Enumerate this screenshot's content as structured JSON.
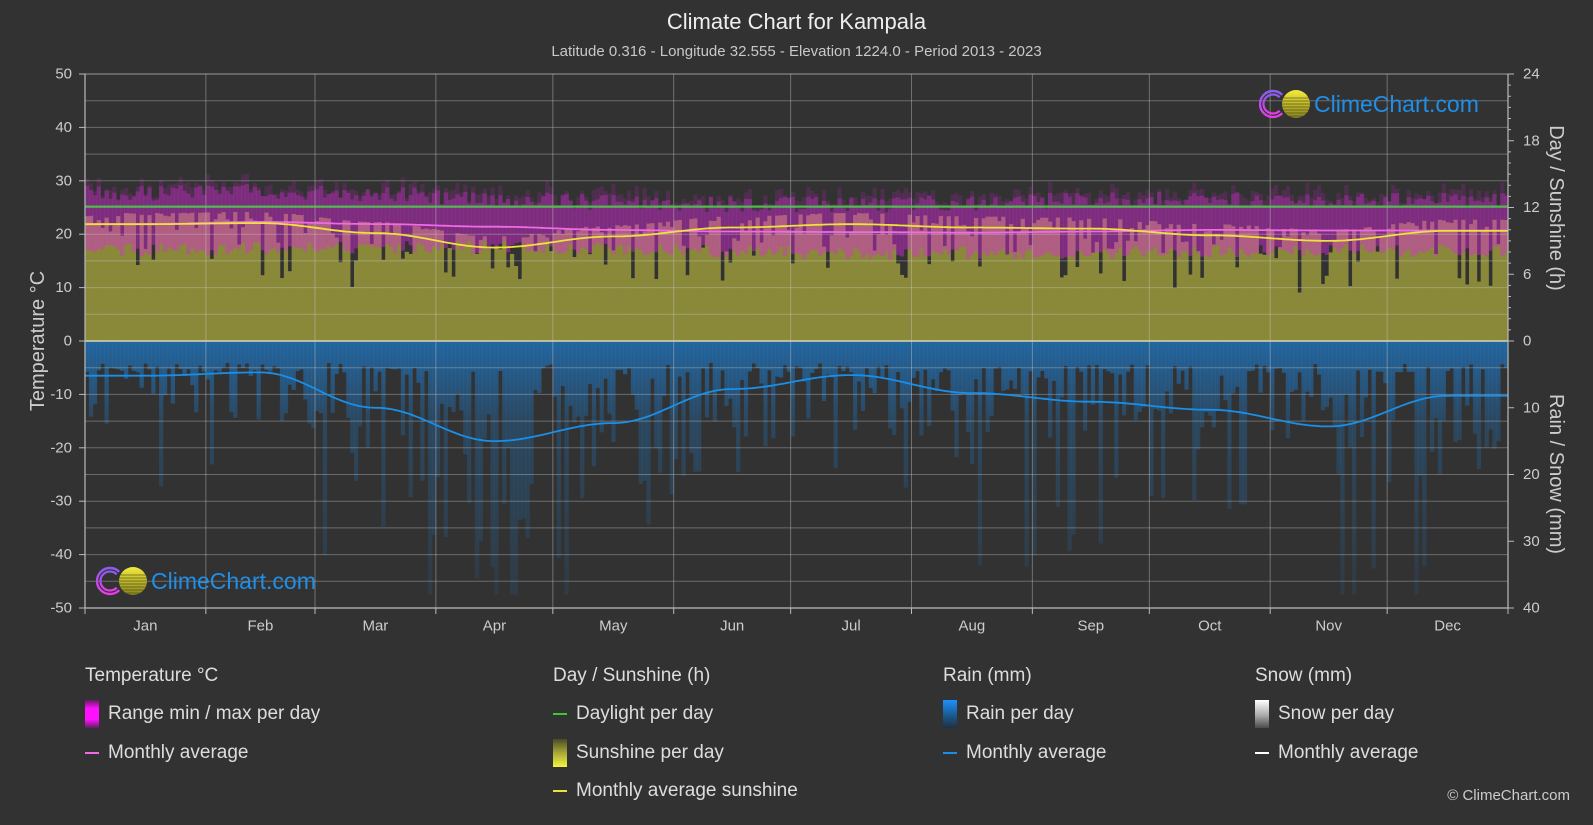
{
  "chart_data": {
    "type": "line",
    "title": "Climate Chart for Kampala",
    "subtitle": "Latitude 0.316 - Longitude 32.555 - Elevation 1224.0 - Period 2013 - 2023",
    "categories": [
      "Jan",
      "Feb",
      "Mar",
      "Apr",
      "May",
      "Jun",
      "Jul",
      "Aug",
      "Sep",
      "Oct",
      "Nov",
      "Dec"
    ],
    "axes": {
      "temperature": {
        "label": "Temperature °C",
        "side": "left",
        "range": [
          -50,
          50
        ],
        "ticks": [
          50,
          40,
          30,
          20,
          10,
          0,
          -10,
          -20,
          -30,
          -40,
          -50
        ]
      },
      "sunshine": {
        "label": "Day / Sunshine (h)",
        "side": "right-upper",
        "range": [
          0,
          24
        ],
        "ticks": [
          24,
          18,
          12,
          6,
          0
        ]
      },
      "precipitation": {
        "label": "Rain / Snow (mm)",
        "side": "right-lower",
        "range": [
          0,
          40
        ],
        "ticks": [
          10,
          20,
          30,
          40
        ]
      }
    },
    "series": [
      {
        "id": "temp_avg",
        "name": "Temperature monthly average (°C)",
        "axis": "temperature",
        "kind": "line",
        "values": [
          21.9,
          22.3,
          21.9,
          21.4,
          20.8,
          20.5,
          20.4,
          20.3,
          20.5,
          20.8,
          20.7,
          20.7
        ]
      },
      {
        "id": "temp_range",
        "name": "Range min / max per day (°C, approximate monthly band)",
        "axis": "temperature",
        "kind": "band",
        "min": [
          17.0,
          17.3,
          17.6,
          17.6,
          17.4,
          16.8,
          16.4,
          16.5,
          16.6,
          16.9,
          17.0,
          16.9
        ],
        "max": [
          27.8,
          28.2,
          27.5,
          26.5,
          26.0,
          25.6,
          25.5,
          25.9,
          26.4,
          26.5,
          26.1,
          26.4
        ]
      },
      {
        "id": "daylight",
        "name": "Daylight per day (h)",
        "axis": "sunshine",
        "kind": "line",
        "values": [
          12.1,
          12.1,
          12.1,
          12.1,
          12.1,
          12.1,
          12.1,
          12.1,
          12.1,
          12.1,
          12.1,
          12.1
        ]
      },
      {
        "id": "sunshine_avg",
        "name": "Monthly average sunshine (h)",
        "axis": "sunshine",
        "kind": "line",
        "values": [
          10.5,
          10.6,
          9.7,
          8.4,
          9.4,
          10.2,
          10.5,
          10.2,
          10.1,
          9.5,
          9.0,
          9.9
        ]
      },
      {
        "id": "rain_avg",
        "name": "Rain monthly average (mm)",
        "axis": "precipitation",
        "kind": "line",
        "values": [
          5.2,
          4.7,
          10.0,
          15.0,
          12.3,
          7.2,
          5.1,
          7.8,
          9.1,
          10.3,
          12.8,
          8.2
        ]
      }
    ],
    "grid": true,
    "legend_position": "bottom"
  },
  "colors": {
    "background": "#323232",
    "text": "#cccccc",
    "grid": "#c8c8c8",
    "axis": "#bbbbbb",
    "zero_line": "#d9d5a8",
    "daylight": "#33cc33",
    "temperature_avg": "#f06ae6",
    "temperature_range": "#e028e0",
    "sunshine_bar": "#8a893a",
    "sunshine_avg": "#ece23a",
    "rain_bar": "#1f74bd",
    "rain_avg": "#1a8fe8",
    "snow_avg": "#ffffff",
    "logo_text": "#1f8fe8"
  },
  "logo": {
    "text": "ClimeChart.com",
    "icon": "climechart-logo-icon"
  },
  "legend": {
    "groups": [
      {
        "title": "Temperature °C",
        "items": [
          {
            "label": "Range min / max per day",
            "icon": "magenta-gradient-swatch"
          },
          {
            "label": "Monthly average",
            "icon": "pink-line"
          }
        ]
      },
      {
        "title": "Day / Sunshine (h)",
        "items": [
          {
            "label": "Daylight per day",
            "icon": "green-line"
          },
          {
            "label": "Sunshine per day",
            "icon": "yellow-gradient-swatch"
          },
          {
            "label": "Monthly average sunshine",
            "icon": "yellow-line"
          }
        ]
      },
      {
        "title": "Rain (mm)",
        "items": [
          {
            "label": "Rain per day",
            "icon": "blue-gradient-swatch"
          },
          {
            "label": "Monthly average",
            "icon": "blue-line"
          }
        ]
      },
      {
        "title": "Snow (mm)",
        "items": [
          {
            "label": "Snow per day",
            "icon": "white-gradient-swatch"
          },
          {
            "label": "Monthly average",
            "icon": "white-line"
          }
        ]
      }
    ]
  },
  "copyright": "© ClimeChart.com"
}
